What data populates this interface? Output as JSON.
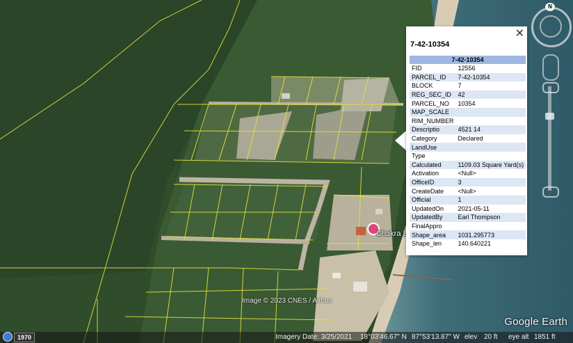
{
  "map": {
    "attribution": "Image © 2023 CNES / Airbus",
    "logo": "Google Earth",
    "placemark_label": "Chakra L",
    "placemark_icon": "pink-pin-icon",
    "colors": {
      "parcel_lines": "#e6e33a",
      "sea": "#3f6f7d",
      "forest": "#2c4a29"
    }
  },
  "historical": {
    "year": "1970"
  },
  "status_bar": {
    "imagery_date": "Imagery Date: 3/25/2021",
    "lat": "18°03'46.67\" N",
    "lon": "87°53'13.87\" W",
    "elev_label": "elev",
    "elev": "20 ft",
    "eye_alt_label": "eye alt",
    "eye_alt": "1851 ft"
  },
  "navigation": {
    "north_label": "N"
  },
  "popup": {
    "title": "7-42-10354",
    "close": "✕",
    "table_header": "7-42-10354",
    "rows": [
      {
        "key": "FID",
        "value": "12556"
      },
      {
        "key": "PARCEL_ID",
        "value": "7-42-10354"
      },
      {
        "key": "BLOCK",
        "value": "7"
      },
      {
        "key": "REG_SEC_ID",
        "value": "42"
      },
      {
        "key": "PARCEL_NO",
        "value": "10354"
      },
      {
        "key": "MAP_SCALE",
        "value": ""
      },
      {
        "key": "RIM_NUMBER",
        "value": ""
      },
      {
        "key": "Descriptio",
        "value": "4521 14"
      },
      {
        "key": "Category",
        "value": "Declared"
      },
      {
        "key": "LandUse",
        "value": ""
      },
      {
        "key": "Type",
        "value": ""
      },
      {
        "key": "Calculated",
        "value": "1109.03 Square Yard(s)"
      },
      {
        "key": "Activation",
        "value": "<Null>"
      },
      {
        "key": "OfficeID",
        "value": "3"
      },
      {
        "key": "CreateDate",
        "value": "<Null>"
      },
      {
        "key": "Official",
        "value": "1"
      },
      {
        "key": "UpdatedOn",
        "value": "2021-05-11"
      },
      {
        "key": "UpdatedBy",
        "value": "Earl Thompson"
      },
      {
        "key": "FinalAppro",
        "value": ""
      },
      {
        "key": "Shape_area",
        "value": "1031.295773"
      },
      {
        "key": "Shape_len",
        "value": "140.640221"
      }
    ]
  }
}
